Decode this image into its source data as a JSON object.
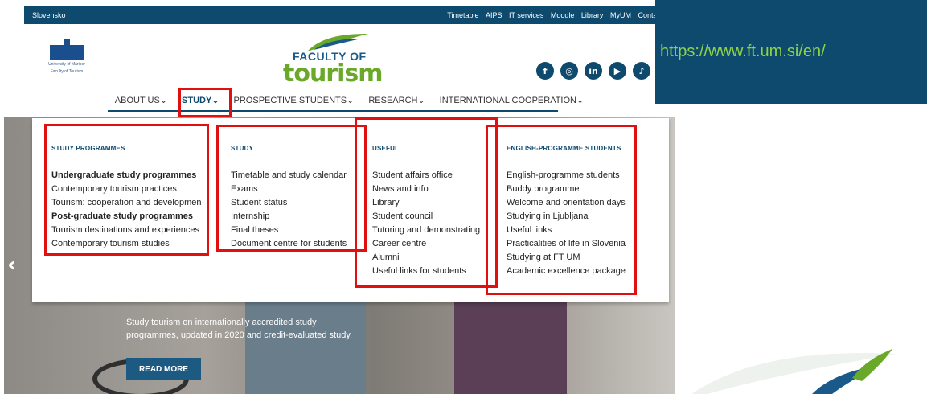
{
  "topbar": {
    "language": "Slovensko",
    "links": [
      "Timetable",
      "AIPS",
      "IT services",
      "Moodle",
      "Library",
      "MyUM",
      "Contacts"
    ]
  },
  "header": {
    "um_logo": {
      "line1": "University of Maribor",
      "line2": "Faculty of Tourism"
    },
    "ft_logo": {
      "line1": "FACULTY OF",
      "line2": "tourism"
    },
    "socials": [
      {
        "icon": "facebook-icon",
        "glyph": "f"
      },
      {
        "icon": "instagram-icon",
        "glyph": "◎"
      },
      {
        "icon": "linkedin-icon",
        "glyph": "in"
      },
      {
        "icon": "youtube-icon",
        "glyph": "▶"
      },
      {
        "icon": "tiktok-icon",
        "glyph": "♪"
      }
    ]
  },
  "nav": {
    "items": [
      "ABOUT US",
      "STUDY",
      "PROSPECTIVE STUDENTS",
      "RESEARCH",
      "INTERNATIONAL COOPERATION"
    ],
    "active": "STUDY",
    "chevron": "⌄"
  },
  "mega_menu": {
    "columns": [
      {
        "heading": "STUDY PROGRAMMES",
        "items": [
          {
            "label": "Undergraduate study programmes",
            "bold": true
          },
          {
            "label": "Contemporary tourism practices",
            "bold": false
          },
          {
            "label": "Tourism: cooperation and developmen",
            "bold": false
          },
          {
            "label": "Post-graduate study programmes",
            "bold": true
          },
          {
            "label": "Tourism destinations and experiences",
            "bold": false
          },
          {
            "label": "Contemporary tourism studies",
            "bold": false
          }
        ]
      },
      {
        "heading": "STUDY",
        "items": [
          {
            "label": "Timetable and study calendar",
            "bold": false
          },
          {
            "label": "Exams",
            "bold": false
          },
          {
            "label": "Student status",
            "bold": false
          },
          {
            "label": "Internship",
            "bold": false
          },
          {
            "label": "Final theses",
            "bold": false
          },
          {
            "label": "Document centre for students",
            "bold": false
          }
        ]
      },
      {
        "heading": "USEFUL",
        "items": [
          {
            "label": "Student affairs office",
            "bold": false
          },
          {
            "label": "News and info",
            "bold": false
          },
          {
            "label": "Library",
            "bold": false
          },
          {
            "label": "Student council",
            "bold": false
          },
          {
            "label": "Tutoring and demonstrating",
            "bold": false
          },
          {
            "label": "Career centre",
            "bold": false
          },
          {
            "label": "Alumni",
            "bold": false
          },
          {
            "label": "Useful links for students",
            "bold": false
          }
        ]
      },
      {
        "heading": "ENGLISH-PROGRAMME STUDENTS",
        "items": [
          {
            "label": "English-programme students",
            "bold": false
          },
          {
            "label": "Buddy programme",
            "bold": false
          },
          {
            "label": "Welcome and orientation days",
            "bold": false
          },
          {
            "label": "Studying in Ljubljana",
            "bold": false
          },
          {
            "label": "Useful links",
            "bold": false
          },
          {
            "label": "Practicalities of life in Slovenia",
            "bold": false
          },
          {
            "label": "Studying at FT UM",
            "bold": false
          },
          {
            "label": "Academic excellence package",
            "bold": false
          }
        ]
      }
    ]
  },
  "hero": {
    "text": "Study tourism on internationally accredited study programmes, updated in 2020 and credit-evaluated study.",
    "button": "READ MORE",
    "prev": "‹",
    "next": "›"
  },
  "url_panel": {
    "url": "https://www.ft.um.si/en/"
  },
  "colors": {
    "brand_blue": "#0d4a6e",
    "brand_green": "#6aa82a",
    "highlight_red": "#e01010",
    "url_green": "#8cd24a"
  }
}
